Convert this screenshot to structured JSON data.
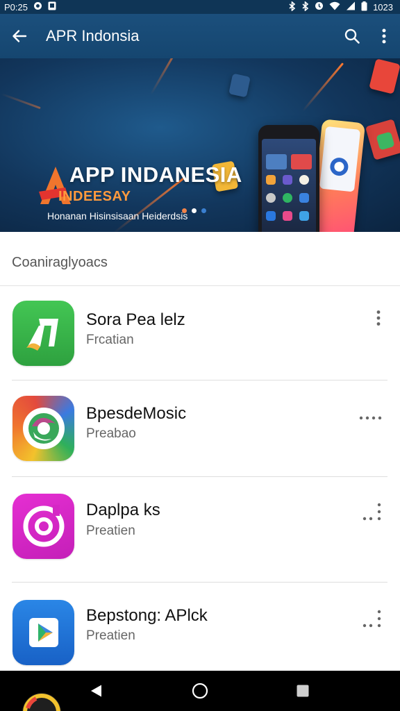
{
  "status_bar": {
    "time_left": "P0:25",
    "time_right": "1023",
    "left_icons": [
      "notification-icon",
      "photo-icon"
    ],
    "right_icons": [
      "bluetooth-icon",
      "bluetooth-icon",
      "alarm-icon",
      "wifi-icon",
      "signal-icon",
      "battery-icon"
    ]
  },
  "app_bar": {
    "title": "APR Indonsia",
    "icons": [
      "back-arrow-icon",
      "search-icon",
      "more-vertical-icon"
    ]
  },
  "banner": {
    "title": "APP INDANESIA",
    "subtitle": "INDEESAY",
    "tagline": "Honanan Hisinsisaan Heiderdsis",
    "dots_active_index": 1,
    "colors": {
      "accent_orange": "#ff7a2f",
      "background": "#12365c"
    }
  },
  "section": {
    "title": "Coaniraglyoacs"
  },
  "apps": [
    {
      "name": "Sora Pea lelz",
      "category": "Frcatian",
      "icon": "green-music-note-icon",
      "overflow": "more-vertical-icon"
    },
    {
      "name": "BpesdeMosic",
      "category": "Preabao",
      "icon": "colorful-music-swirl-icon",
      "overflow": "more-horizontal-icon"
    },
    {
      "name": "Daplpa ks",
      "category": "Preatien",
      "icon": "pink-target-icon",
      "overflow": "more-icon"
    },
    {
      "name": "Bepstong: APlck",
      "category": "Preatien",
      "icon": "blue-play-icon",
      "overflow": "more-icon"
    }
  ],
  "nav_bar": {
    "icons": [
      "back-triangle-icon",
      "home-circle-icon",
      "recents-square-icon"
    ]
  }
}
